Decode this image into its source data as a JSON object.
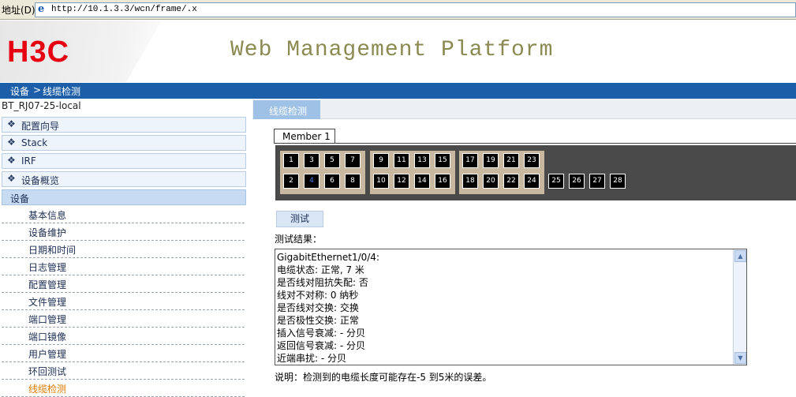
{
  "browser": {
    "address_label": "地址(D)",
    "url": "http://10.1.3.3/wcn/frame/.x",
    "icon": "ie-icon"
  },
  "header": {
    "logo": "H3C",
    "title": "Web Management Platform"
  },
  "breadcrumb": {
    "parent": "设备",
    "separator": ">",
    "current": "线缆检测"
  },
  "sidebar": {
    "device_name": "BT_RJ07-25-local",
    "sections": [
      {
        "label": "配置向导",
        "icon": "diamond-icon"
      },
      {
        "label": "Stack",
        "icon": "diamond-icon"
      },
      {
        "label": "IRF",
        "icon": "diamond-icon"
      },
      {
        "label": "设备概览",
        "icon": "diamond-icon"
      }
    ],
    "open_section": "设备",
    "items": [
      {
        "label": "基本信息"
      },
      {
        "label": "设备维护"
      },
      {
        "label": "日期和时间"
      },
      {
        "label": "日志管理"
      },
      {
        "label": "配置管理"
      },
      {
        "label": "文件管理"
      },
      {
        "label": "端口管理"
      },
      {
        "label": "端口镜像"
      },
      {
        "label": "用户管理"
      },
      {
        "label": "环回测试"
      },
      {
        "label": "线缆检测",
        "active": true
      }
    ]
  },
  "main": {
    "tab": "线缆检测",
    "member_tab": "Member 1",
    "ports": {
      "top_row": [
        "1",
        "3",
        "5",
        "7",
        "9",
        "11",
        "13",
        "15",
        "17",
        "19",
        "21",
        "23"
      ],
      "bottom_row": [
        "2",
        "4",
        "6",
        "8",
        "10",
        "12",
        "14",
        "16",
        "18",
        "20",
        "22",
        "24"
      ],
      "extra": [
        "25",
        "26",
        "27",
        "28"
      ],
      "selected": "4"
    },
    "test_button": "测试",
    "result_label": "测试结果：",
    "result_lines": [
      "GigabitEthernet1/0/4:",
      "电缆状态: 正常, 7 米",
      "是否线对阻抗失配: 否",
      "线对不对称: 0 纳秒",
      "是否线对交换: 交换",
      "是否极性交换: 正常",
      "插入信号衰减: - 分贝",
      "返回信号衰减: - 分贝",
      "近端串扰: - 分贝"
    ],
    "note": "说明：检测到的电缆长度可能存在-5 到5米的误差。"
  },
  "colors": {
    "brand_red": "#e60012",
    "breadcrumb_bg": "#1c5fa8",
    "active_item": "#e07a00"
  }
}
